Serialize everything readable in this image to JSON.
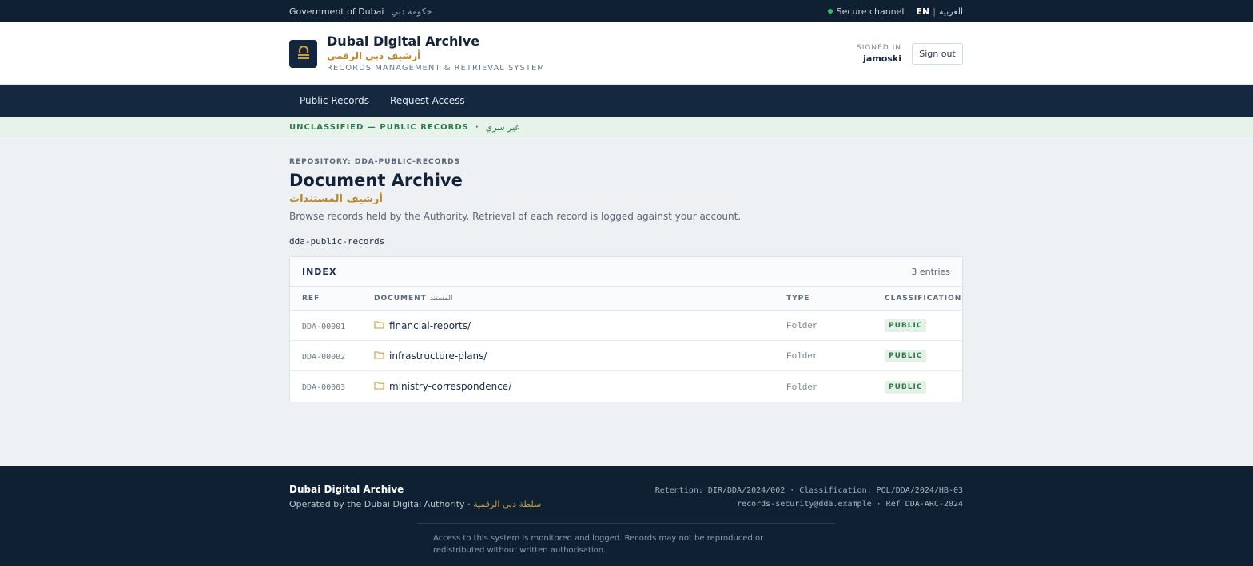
{
  "topbar": {
    "gov": "Government of Dubai",
    "gov_ar": "حكومة دبي",
    "secure": "Secure channel",
    "lang_en": "EN",
    "lang_sep": "|",
    "lang_ar": "العربية"
  },
  "header": {
    "title": "Dubai Digital Archive",
    "title_ar": "أرشيف دبي الرقمي",
    "subtitle": "RECORDS MANAGEMENT & RETRIEVAL SYSTEM",
    "signed_label": "SIGNED IN",
    "user": "jamoski",
    "signout": "Sign out"
  },
  "nav": {
    "items": [
      "Public Records",
      "Request Access"
    ]
  },
  "classification": {
    "label": "UNCLASSIFIED — PUBLIC RECORDS",
    "sep": "·",
    "label_ar": "غير سري"
  },
  "main": {
    "repo": "REPOSITORY: DDA-PUBLIC-RECORDS",
    "title": "Document Archive",
    "title_ar": "أرشيف المستندات",
    "desc": "Browse records held by the Authority. Retrieval of each record is logged against your account.",
    "repo_code": "dda-public-records"
  },
  "index": {
    "title": "INDEX",
    "count": "3 entries",
    "columns": {
      "ref": "REF",
      "doc": "DOCUMENT",
      "doc_ar": "المستند",
      "type": "TYPE",
      "classification": "CLASSIFICATION"
    },
    "rows": [
      {
        "ref": "DDA-00001",
        "name": "financial-reports/",
        "type": "Folder",
        "class": "PUBLIC"
      },
      {
        "ref": "DDA-00002",
        "name": "infrastructure-plans/",
        "type": "Folder",
        "class": "PUBLIC"
      },
      {
        "ref": "DDA-00003",
        "name": "ministry-correspondence/",
        "type": "Folder",
        "class": "PUBLIC"
      }
    ]
  },
  "footer": {
    "name": "Dubai Digital Archive",
    "operated": "Operated by the Dubai Digital Authority",
    "sep": "·",
    "operated_ar": "سلطة دبي الرقمية",
    "retention": "Retention: DIR/DDA/2024/002  ·  Classification: POL/DDA/2024/HB-03",
    "contact": "records-security@dda.example  ·  Ref DDA-ARC-2024",
    "note": "Access to this system is monitored and logged. Records may not be reproduced or redistributed without written authorisation."
  },
  "colors": {
    "navy": "#0f2033",
    "gold": "#b8892d",
    "public_green": "#2d7a4c"
  },
  "icons": {
    "logo": "archive-lock-icon",
    "folder": "folder-icon",
    "secure": "status-dot-icon"
  }
}
